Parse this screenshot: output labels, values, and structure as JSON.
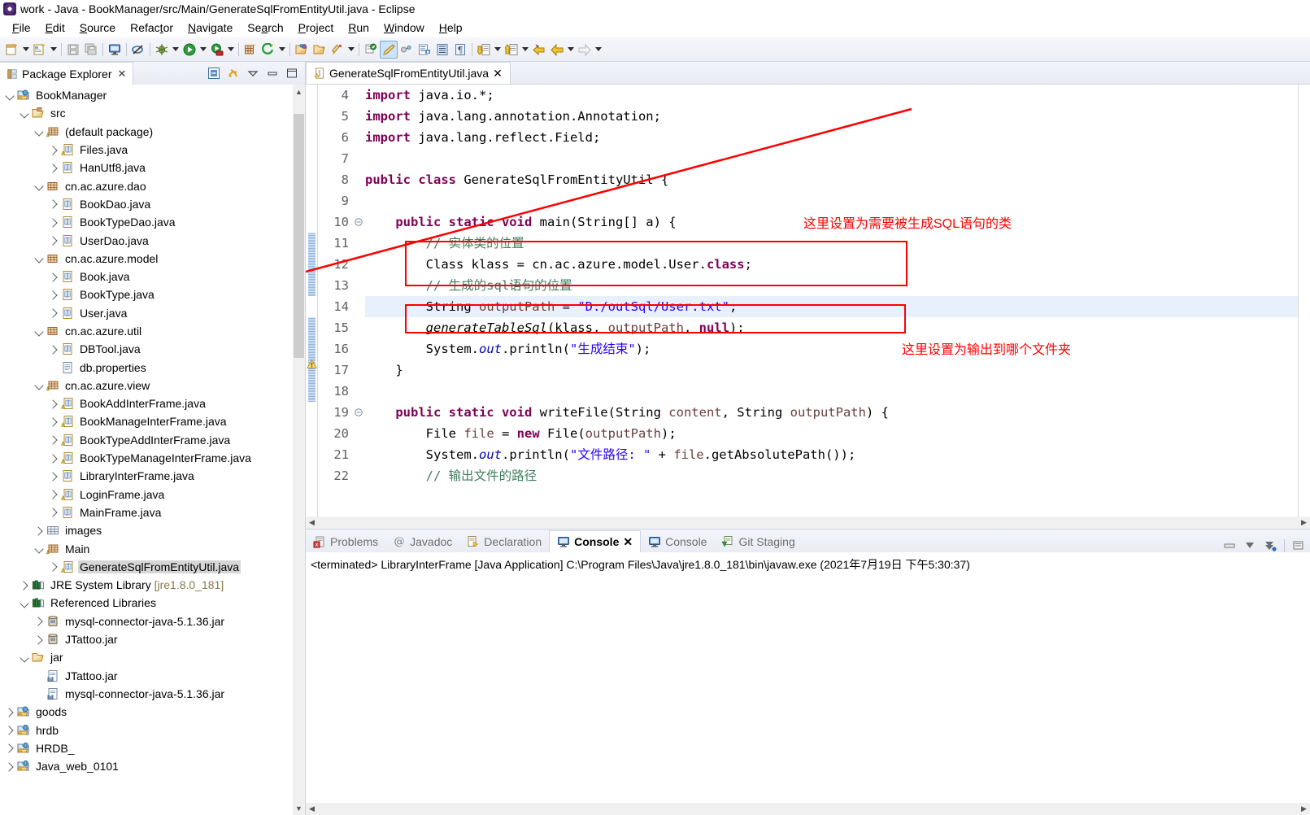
{
  "window": {
    "title": "work - Java - BookManager/src/Main/GenerateSqlFromEntityUtil.java - Eclipse",
    "app_icon": "eclipse-icon"
  },
  "menubar": {
    "items": [
      {
        "label": "File",
        "mnemonic": "F"
      },
      {
        "label": "Edit",
        "mnemonic": "E"
      },
      {
        "label": "Source",
        "mnemonic": "S"
      },
      {
        "label": "Refactor",
        "mnemonic": "t"
      },
      {
        "label": "Navigate",
        "mnemonic": "N"
      },
      {
        "label": "Search",
        "mnemonic": "a"
      },
      {
        "label": "Project",
        "mnemonic": "P"
      },
      {
        "label": "Run",
        "mnemonic": "R"
      },
      {
        "label": "Window",
        "mnemonic": "W"
      },
      {
        "label": "Help",
        "mnemonic": "H"
      }
    ]
  },
  "toolbar": {
    "items": [
      {
        "icon": "new-java-project-icon",
        "dropdown": true
      },
      {
        "icon": "new-java-class-icon",
        "dropdown": true
      },
      {
        "sep": true
      },
      {
        "icon": "save-icon",
        "dropdown": false
      },
      {
        "icon": "save-all-icon",
        "dropdown": false
      },
      {
        "sep": true
      },
      {
        "icon": "console-view-icon",
        "dropdown": false
      },
      {
        "sep": true
      },
      {
        "icon": "skip-breakpoints-icon",
        "dropdown": false
      },
      {
        "sep": true
      },
      {
        "icon": "debug-icon",
        "dropdown": true
      },
      {
        "icon": "run-icon",
        "dropdown": true
      },
      {
        "icon": "run-coverage-icon",
        "dropdown": true
      },
      {
        "sep": true
      },
      {
        "icon": "new-java-package-icon",
        "dropdown": false
      },
      {
        "icon": "external-tools-icon",
        "dropdown": true
      },
      {
        "sep": true
      },
      {
        "icon": "open-type-icon",
        "dropdown": false
      },
      {
        "icon": "open-task-icon",
        "dropdown": false
      },
      {
        "icon": "search-pencil-icon",
        "dropdown": true
      },
      {
        "sep": true
      },
      {
        "icon": "last-edit-location-icon",
        "dropdown": false
      },
      {
        "icon": "toggle-markoccurrences-icon",
        "dropdown": false,
        "selected": true
      },
      {
        "icon": "link-editor-icon",
        "dropdown": false
      },
      {
        "icon": "next-annotation-icon",
        "dropdown": false
      },
      {
        "icon": "show-whitespace-icon",
        "dropdown": false
      },
      {
        "icon": "pilcrow-icon",
        "dropdown": false
      },
      {
        "sep": true
      },
      {
        "icon": "next-annotation-down-icon",
        "dropdown": true
      },
      {
        "icon": "previous-annotation-up-icon",
        "dropdown": true
      },
      {
        "icon": "back-to-edit-icon",
        "dropdown": false
      },
      {
        "icon": "back-icon",
        "dropdown": true
      },
      {
        "icon": "forward-icon",
        "dropdown": true
      }
    ]
  },
  "package_explorer": {
    "tab_label": "Package Explorer",
    "close_glyph": "✕",
    "header_tools": [
      "collapse-all-icon",
      "link-with-editor-icon",
      "view-menu-icon",
      "minimize-icon",
      "maximize-icon"
    ],
    "tree": [
      {
        "depth": 0,
        "twisty": "down",
        "icon": "java-project-icon",
        "label": "BookManager"
      },
      {
        "depth": 1,
        "twisty": "down",
        "icon": "source-folder-icon",
        "label": "src"
      },
      {
        "depth": 2,
        "twisty": "down",
        "icon": "package-warn-icon",
        "label": "(default package)"
      },
      {
        "depth": 3,
        "twisty": "right",
        "icon": "java-file-warn-icon",
        "label": "Files.java"
      },
      {
        "depth": 3,
        "twisty": "right",
        "icon": "java-file-icon",
        "label": "HanUtf8.java"
      },
      {
        "depth": 2,
        "twisty": "down",
        "icon": "package-icon",
        "label": "cn.ac.azure.dao"
      },
      {
        "depth": 3,
        "twisty": "right",
        "icon": "java-file-icon",
        "label": "BookDao.java"
      },
      {
        "depth": 3,
        "twisty": "right",
        "icon": "java-file-icon",
        "label": "BookTypeDao.java"
      },
      {
        "depth": 3,
        "twisty": "right",
        "icon": "java-file-icon",
        "label": "UserDao.java"
      },
      {
        "depth": 2,
        "twisty": "down",
        "icon": "package-icon",
        "label": "cn.ac.azure.model"
      },
      {
        "depth": 3,
        "twisty": "right",
        "icon": "java-file-icon",
        "label": "Book.java"
      },
      {
        "depth": 3,
        "twisty": "right",
        "icon": "java-file-icon",
        "label": "BookType.java"
      },
      {
        "depth": 3,
        "twisty": "right",
        "icon": "java-file-icon",
        "label": "User.java"
      },
      {
        "depth": 2,
        "twisty": "down",
        "icon": "package-icon",
        "label": "cn.ac.azure.util"
      },
      {
        "depth": 3,
        "twisty": "right",
        "icon": "java-file-icon",
        "label": "DBTool.java"
      },
      {
        "depth": 3,
        "twisty": "none",
        "icon": "properties-file-icon",
        "label": "db.properties"
      },
      {
        "depth": 2,
        "twisty": "down",
        "icon": "package-warn-icon",
        "label": "cn.ac.azure.view"
      },
      {
        "depth": 3,
        "twisty": "right",
        "icon": "java-file-warn-icon",
        "label": "BookAddInterFrame.java"
      },
      {
        "depth": 3,
        "twisty": "right",
        "icon": "java-file-warn-icon",
        "label": "BookManageInterFrame.java"
      },
      {
        "depth": 3,
        "twisty": "right",
        "icon": "java-file-warn-icon",
        "label": "BookTypeAddInterFrame.java"
      },
      {
        "depth": 3,
        "twisty": "right",
        "icon": "java-file-warn-icon",
        "label": "BookTypeManageInterFrame.java"
      },
      {
        "depth": 3,
        "twisty": "right",
        "icon": "java-file-icon",
        "label": "LibraryInterFrame.java"
      },
      {
        "depth": 3,
        "twisty": "right",
        "icon": "java-file-warn-icon",
        "label": "LoginFrame.java"
      },
      {
        "depth": 3,
        "twisty": "right",
        "icon": "java-file-icon",
        "label": "MainFrame.java"
      },
      {
        "depth": 2,
        "twisty": "right",
        "icon": "folder-package-icon",
        "label": "images"
      },
      {
        "depth": 2,
        "twisty": "down",
        "icon": "package-warn-icon",
        "label": "Main"
      },
      {
        "depth": 3,
        "twisty": "right",
        "icon": "java-file-warn-icon",
        "label": "GenerateSqlFromEntityUtil.java",
        "selected": true
      },
      {
        "depth": 1,
        "twisty": "right",
        "icon": "library-icon",
        "label": "JRE System Library ",
        "suffix": "[jre1.8.0_181]"
      },
      {
        "depth": 1,
        "twisty": "down",
        "icon": "library-icon",
        "label": "Referenced Libraries"
      },
      {
        "depth": 2,
        "twisty": "right",
        "icon": "jar-icon",
        "label": "mysql-connector-java-5.1.36.jar"
      },
      {
        "depth": 2,
        "twisty": "right",
        "icon": "jar-icon",
        "label": "JTattoo.jar"
      },
      {
        "depth": 1,
        "twisty": "down",
        "icon": "folder-icon",
        "label": "jar"
      },
      {
        "depth": 2,
        "twisty": "none",
        "icon": "jar-file-icon",
        "label": "JTattoo.jar"
      },
      {
        "depth": 2,
        "twisty": "none",
        "icon": "jar-file-icon",
        "label": "mysql-connector-java-5.1.36.jar"
      },
      {
        "depth": 0,
        "twisty": "right",
        "icon": "java-project-icon",
        "label": "goods"
      },
      {
        "depth": 0,
        "twisty": "right",
        "icon": "web-project-icon",
        "label": "hrdb"
      },
      {
        "depth": 0,
        "twisty": "right",
        "icon": "web-project-icon",
        "label": "HRDB_"
      },
      {
        "depth": 0,
        "twisty": "right",
        "icon": "web-project-icon",
        "label": "Java_web_0101"
      }
    ]
  },
  "editor": {
    "tab": {
      "label": "GenerateSqlFromEntityUtil.java",
      "icon": "java-file-warn-icon",
      "close_glyph": "✕"
    },
    "first_line_number": 4,
    "highlighted_line": 14,
    "fold_lines": [
      10,
      19
    ],
    "lines": [
      {
        "n": 4,
        "tokens": [
          {
            "t": "import",
            "c": "kw"
          },
          {
            "t": " java.io.*;",
            "c": ""
          }
        ]
      },
      {
        "n": 5,
        "tokens": [
          {
            "t": "import",
            "c": "kw"
          },
          {
            "t": " java.lang.annotation.Annotation;",
            "c": ""
          }
        ]
      },
      {
        "n": 6,
        "tokens": [
          {
            "t": "import",
            "c": "kw"
          },
          {
            "t": " java.lang.reflect.Field;",
            "c": ""
          }
        ]
      },
      {
        "n": 7,
        "tokens": []
      },
      {
        "n": 8,
        "tokens": [
          {
            "t": "public class",
            "c": "kw"
          },
          {
            "t": " GenerateSqlFromEntityUtil {",
            "c": ""
          }
        ]
      },
      {
        "n": 9,
        "tokens": []
      },
      {
        "n": 10,
        "tokens": [
          {
            "t": "    ",
            "c": ""
          },
          {
            "t": "public static void",
            "c": "kw"
          },
          {
            "t": " main(String[] a) {",
            "c": ""
          }
        ]
      },
      {
        "n": 11,
        "tokens": [
          {
            "t": "        ",
            "c": ""
          },
          {
            "t": "// 实体类的位置",
            "c": "cmt"
          }
        ]
      },
      {
        "n": 12,
        "tokens": [
          {
            "t": "        Class klass = cn.ac.azure.model.User.",
            "c": ""
          },
          {
            "t": "class",
            "c": "kw"
          },
          {
            "t": ";",
            "c": ""
          }
        ]
      },
      {
        "n": 13,
        "tokens": [
          {
            "t": "        ",
            "c": ""
          },
          {
            "t": "// 生成的sql语句的位置",
            "c": "cmt"
          }
        ]
      },
      {
        "n": 14,
        "tokens": [
          {
            "t": "        String ",
            "c": ""
          },
          {
            "t": "outputPath",
            "c": "param"
          },
          {
            "t": " = ",
            "c": ""
          },
          {
            "t": "\"D:/outSql/User.txt\"",
            "c": "str"
          },
          {
            "t": ";",
            "c": ""
          }
        ]
      },
      {
        "n": 15,
        "tokens": [
          {
            "t": "        ",
            "c": ""
          },
          {
            "t": "generateTableSql",
            "c": "ital"
          },
          {
            "t": "(klass, ",
            "c": ""
          },
          {
            "t": "outputPath",
            "c": "param"
          },
          {
            "t": ", ",
            "c": ""
          },
          {
            "t": "null",
            "c": "kw"
          },
          {
            "t": ");",
            "c": ""
          }
        ]
      },
      {
        "n": 16,
        "tokens": [
          {
            "t": "        System.",
            "c": ""
          },
          {
            "t": "out",
            "c": "fldital"
          },
          {
            "t": ".println(",
            "c": ""
          },
          {
            "t": "\"生成结束\"",
            "c": "str"
          },
          {
            "t": ");",
            "c": ""
          }
        ]
      },
      {
        "n": 17,
        "tokens": [
          {
            "t": "    }",
            "c": ""
          }
        ]
      },
      {
        "n": 18,
        "tokens": []
      },
      {
        "n": 19,
        "tokens": [
          {
            "t": "    ",
            "c": ""
          },
          {
            "t": "public static void",
            "c": "kw"
          },
          {
            "t": " writeFile(String ",
            "c": ""
          },
          {
            "t": "content",
            "c": "param"
          },
          {
            "t": ", String ",
            "c": ""
          },
          {
            "t": "outputPath",
            "c": "param"
          },
          {
            "t": ") {",
            "c": ""
          }
        ]
      },
      {
        "n": 20,
        "tokens": [
          {
            "t": "        File ",
            "c": ""
          },
          {
            "t": "file",
            "c": "param"
          },
          {
            "t": " = ",
            "c": ""
          },
          {
            "t": "new",
            "c": "kw"
          },
          {
            "t": " File(",
            "c": ""
          },
          {
            "t": "outputPath",
            "c": "param"
          },
          {
            "t": ");",
            "c": ""
          }
        ]
      },
      {
        "n": 21,
        "tokens": [
          {
            "t": "        System.",
            "c": ""
          },
          {
            "t": "out",
            "c": "fldital"
          },
          {
            "t": ".println(",
            "c": ""
          },
          {
            "t": "\"文件路径: \"",
            "c": "str"
          },
          {
            "t": " + ",
            "c": ""
          },
          {
            "t": "file",
            "c": "param"
          },
          {
            "t": ".getAbsolutePath());",
            "c": ""
          }
        ]
      },
      {
        "n": 22,
        "tokens": [
          {
            "t": "        ",
            "c": ""
          },
          {
            "t": "// 输出文件的路径",
            "c": "cmt"
          }
        ]
      }
    ],
    "annotations": [
      {
        "id": "anno-class-note",
        "text": "这里设置为需要被生成SQL语句的类",
        "color": "#ff0000"
      },
      {
        "id": "anno-output-note",
        "text": "这里设置为输出到哪个文件夹",
        "color": "#ff0000"
      }
    ],
    "arrow": {
      "id": "red-arrow-to-bookdao",
      "color": "#ff0000"
    }
  },
  "bottom_panel": {
    "tabs": [
      {
        "label": "Problems",
        "icon": "problems-icon",
        "active": false
      },
      {
        "label": "Javadoc",
        "icon": "javadoc-icon",
        "active": false
      },
      {
        "label": "Declaration",
        "icon": "declaration-icon",
        "active": false
      },
      {
        "label": "Console",
        "icon": "console-icon",
        "active": true,
        "close_glyph": "✕"
      },
      {
        "label": "Console",
        "icon": "console-icon",
        "active": false
      },
      {
        "label": "Git Staging",
        "icon": "git-staging-icon",
        "active": false
      }
    ],
    "tools": [
      "minimize-view-icon",
      "terminate-icon",
      "remove-all-terminated-icon",
      "display-selected-console-icon"
    ],
    "console_text": "<terminated> LibraryInterFrame [Java Application] C:\\Program Files\\Java\\jre1.8.0_181\\bin\\javaw.exe (2021年7月19日 下午5:30:37)"
  },
  "colors": {
    "accent_red": "#ff0000",
    "keyword": "#7f0055",
    "string": "#2a00ff",
    "comment": "#3f7f5f",
    "selection": "#e8f0fc",
    "tree_selection": "#d6d6d6"
  }
}
